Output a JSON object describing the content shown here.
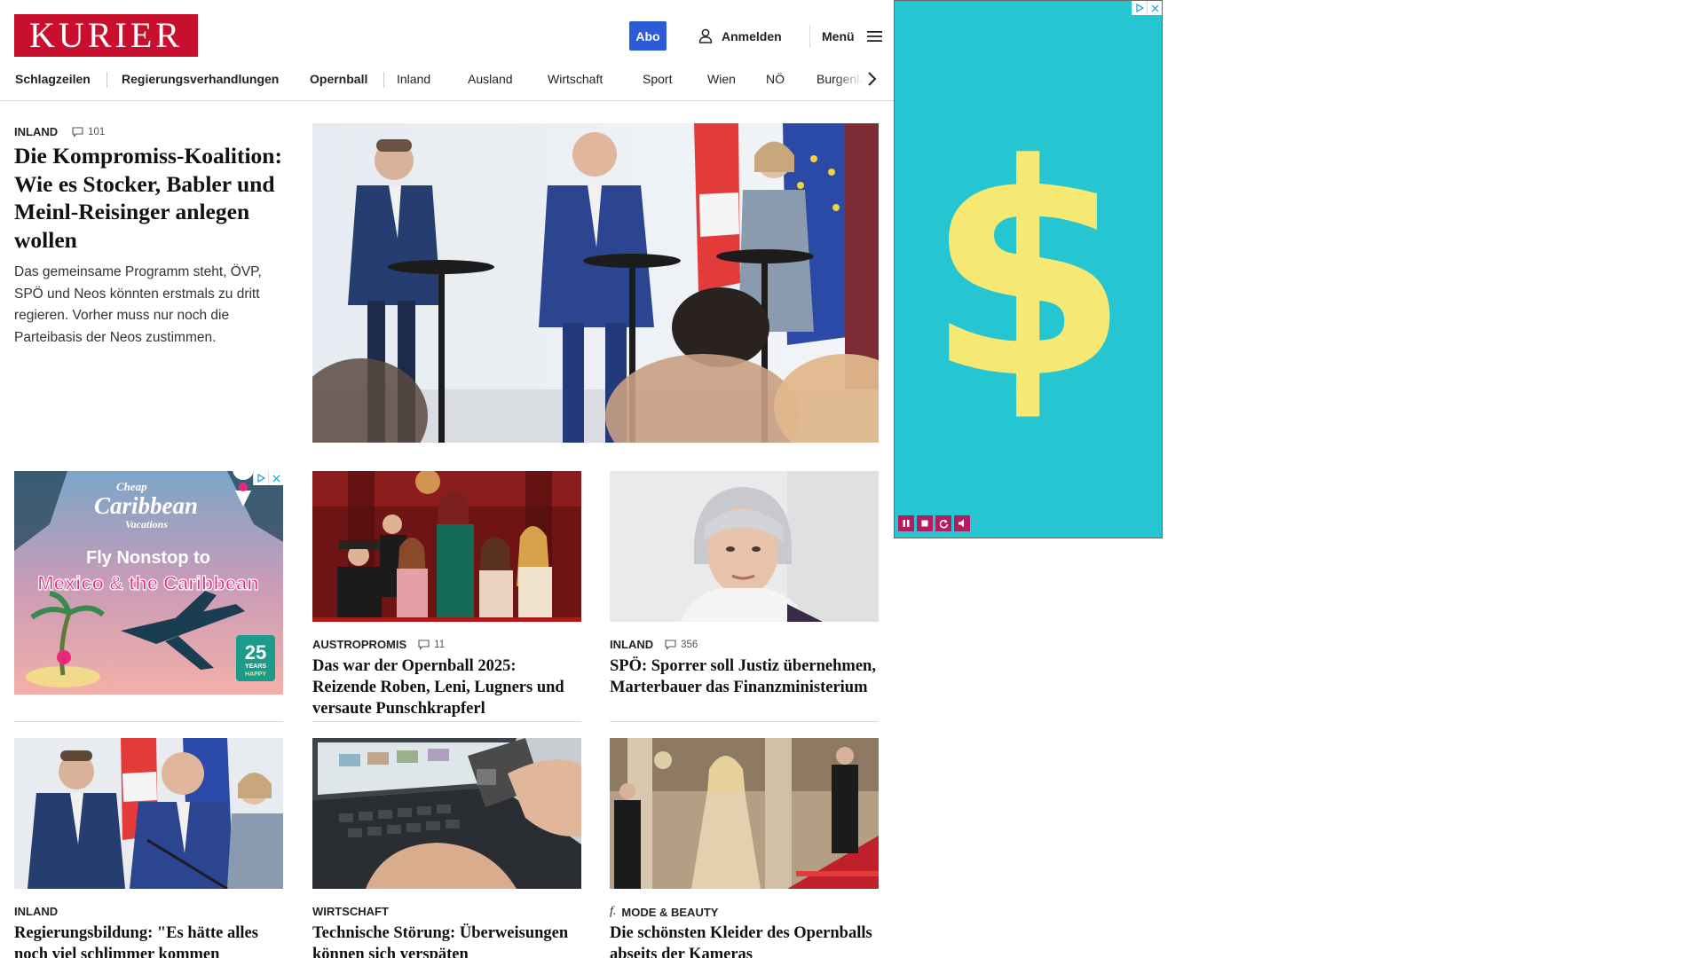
{
  "header": {
    "logo": "KURIER",
    "abo_label": "Abo",
    "login_label": "Anmelden",
    "menu_label": "Menü"
  },
  "nav": {
    "items": [
      "Schlagzeilen",
      "Regierungsverhandlungen",
      "Opernball",
      "Inland",
      "Ausland",
      "Wirtschaft",
      "Sport",
      "Wien",
      "NÖ",
      "Burgenland"
    ]
  },
  "lead": {
    "kicker": "INLAND",
    "comments": "101",
    "title": "Die Kompromiss-Koalition: Wie es Stocker, Babler und Meinl-Reisinger anlegen wollen",
    "teaser": "Das gemeinsame Programm steht, ÖVP, SPÖ und Neos könnten erstmals zu dritt regieren. Vorher muss nur noch die Parteibasis der Neos zustimmen."
  },
  "ad_tile": {
    "brand_line1": "Cheap",
    "brand_line2": "Caribbean",
    "brand_line3": "Vacations",
    "headline1": "Fly Nonstop to",
    "headline2": "Mexico & the Caribbean",
    "badge_number": "25",
    "badge_text1": "YEARS",
    "badge_text2": "HAPPY"
  },
  "cards": [
    {
      "kicker": "AUSTROPROMIS",
      "comments": "11",
      "title": "Das war der Opernball 2025: Reizende Roben, Leni, Lugners und versaute Punschkrapferl"
    },
    {
      "kicker": "INLAND",
      "comments": "356",
      "title": "SPÖ: Sporrer soll Justiz übernehmen, Marterbauer das Finanzministerium"
    },
    {
      "kicker": "INLAND",
      "title": "Regierungsbildung: \"Es hätte alles noch viel schlimmer kommen können\""
    },
    {
      "kicker": "WIRTSCHAFT",
      "title": "Technische Störung: Überweisungen können sich verspäten"
    },
    {
      "kicker": "MODE & BEAUTY",
      "brand_mark": "f.",
      "title": "Die schönsten Kleider des Opernballs abseits der Kameras"
    }
  ],
  "sky_ad": {
    "symbol": "$",
    "colors": {
      "background": "#25c6d2",
      "symbol": "#f5e873",
      "controls": "#b31c5f"
    }
  },
  "colors": {
    "brand": "#c8102e",
    "abo": "#2b5bd7"
  }
}
